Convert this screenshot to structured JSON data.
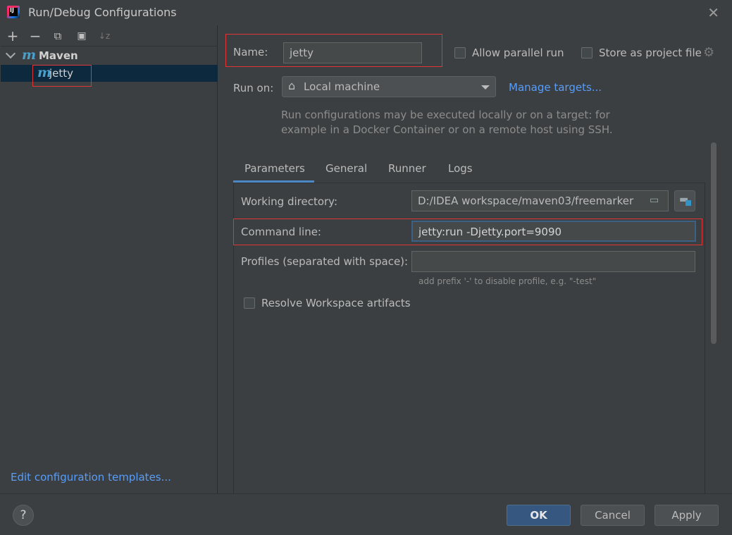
{
  "window": {
    "title": "Run/Debug Configurations",
    "close_glyph": "✕"
  },
  "toolbar": {
    "add": "+",
    "remove": "−",
    "copy": "⧉",
    "folder": "▣",
    "sort": "↓z"
  },
  "tree": {
    "group_icon": "m",
    "group_label": "Maven",
    "item_icon": "m",
    "item_label": "jetty"
  },
  "templates_link": "Edit configuration templates...",
  "form": {
    "name_label": "Name:",
    "name_value": "jetty",
    "allow_parallel_label": "Allow parallel run",
    "store_project_label": "Store as project file",
    "run_on_label": "Run on:",
    "run_on_value": "Local machine",
    "manage_targets": "Manage targets...",
    "run_info_line1": "Run configurations may be executed locally or on a target: for",
    "run_info_line2": "example in a Docker Container or on a remote host using SSH."
  },
  "tabs": [
    "Parameters",
    "General",
    "Runner",
    "Logs"
  ],
  "parameters": {
    "working_dir_label": "Working directory:",
    "working_dir_value": "D:/IDEA workspace/maven03/freemarker",
    "command_line_label": "Command line:",
    "command_line_value": "jetty:run -Djetty.port=9090",
    "profiles_label": "Profiles (separated with space):",
    "profiles_value": "",
    "profiles_hint": "add prefix '-' to disable profile, e.g. \"-test\"",
    "resolve_label": "Resolve Workspace artifacts"
  },
  "buttons": {
    "help": "?",
    "ok": "OK",
    "cancel": "Cancel",
    "apply": "Apply"
  },
  "colors": {
    "accent": "#4a88c7",
    "link": "#589df6",
    "highlight": "#e03535",
    "selection": "#0d293e",
    "maven": "#4c9fc9"
  }
}
